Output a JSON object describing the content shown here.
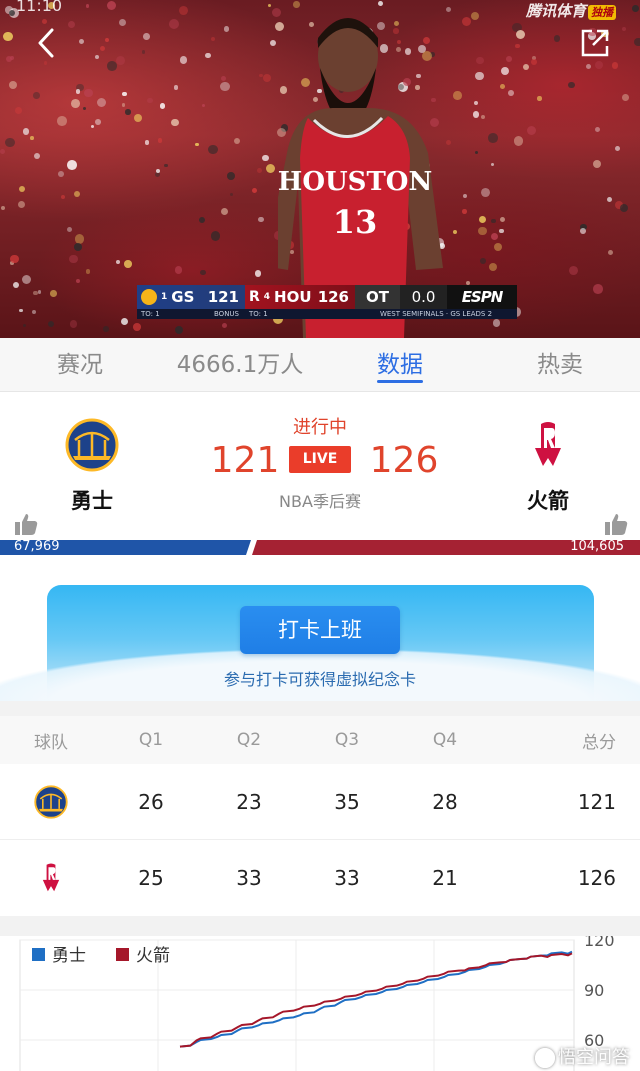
{
  "video": {
    "status_time": "11:10",
    "broadcaster": "腾讯体育",
    "broadcaster_tag": "独播",
    "scorebug": {
      "away_seed": "1",
      "away_abbr": "GS",
      "away_score": "121",
      "home_seed": "4",
      "home_abbr": "HOU",
      "home_score": "126",
      "period": "OT",
      "clock": "0.0",
      "network": "ESPN",
      "away_timeouts": "TO: 1",
      "bonus": "BONUS",
      "home_timeouts": "TO: 1",
      "series": "WEST SEMIFINALS · GS LEADS 2"
    },
    "jersey_text": "HOUSTON",
    "jersey_number": "13"
  },
  "tabs": [
    {
      "label": "赛况",
      "active": false
    },
    {
      "label": "4666.1万人",
      "active": false
    },
    {
      "label": "数据",
      "active": true
    },
    {
      "label": "热卖",
      "active": false
    }
  ],
  "match": {
    "status": "进行中",
    "away_team": "勇士",
    "home_team": "火箭",
    "away_score": "121",
    "home_score": "126",
    "live_label": "LIVE",
    "league": "NBA季后赛",
    "away_support": "67,969",
    "home_support": "104,605",
    "away_color": "#1f55a8",
    "home_color": "#a52233"
  },
  "checkin": {
    "button_label": "打卡上班",
    "subtitle": "参与打卡可获得虚拟纪念卡"
  },
  "quarters": {
    "headers": [
      "球队",
      "Q1",
      "Q2",
      "Q3",
      "Q4",
      "总分"
    ],
    "rows": [
      {
        "team": "勇士",
        "q": [
          "26",
          "23",
          "35",
          "28"
        ],
        "total": "121"
      },
      {
        "team": "火箭",
        "q": [
          "25",
          "33",
          "33",
          "21"
        ],
        "total": "126"
      }
    ]
  },
  "chart_data": {
    "type": "line",
    "title": "",
    "xlabel": "",
    "ylabel": "",
    "ylim": [
      60,
      120
    ],
    "y_ticks": [
      "120",
      "90",
      "60"
    ],
    "grid": true,
    "legend_placement": "top-left",
    "series": [
      {
        "name": "勇士",
        "color": "#1f6fc4",
        "values": [
          56,
          60,
          63,
          67,
          70,
          73,
          76,
          80,
          84,
          87,
          90,
          93,
          96,
          99,
          102,
          105,
          108,
          110,
          112,
          113
        ]
      },
      {
        "name": "火箭",
        "color": "#a5172a",
        "values": [
          56,
          61,
          65,
          69,
          73,
          77,
          80,
          83,
          86,
          89,
          92,
          95,
          98,
          101,
          103,
          106,
          108,
          110,
          111,
          112
        ]
      }
    ]
  },
  "watermark": "悟空问答"
}
